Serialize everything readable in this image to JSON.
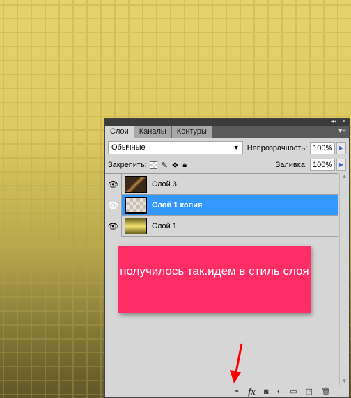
{
  "panel": {
    "tabs": [
      "Слои",
      "Каналы",
      "Контуры"
    ],
    "blend_mode": "Обычные",
    "opacity_label": "Непрозрачность:",
    "opacity": "100%",
    "lock_label": "Закрепить:",
    "fill_label": "Заливка:",
    "fill": "100%",
    "layers": [
      {
        "name": "Слой 3",
        "selected": false
      },
      {
        "name": "Слой 1 копия",
        "selected": true
      },
      {
        "name": "Слой 1",
        "selected": false
      }
    ],
    "bottom_icons": [
      "link-icon",
      "fx-icon",
      "mask-icon",
      "adjustment-icon",
      "folder-icon",
      "new-layer-icon",
      "trash-icon"
    ],
    "fx_label": "fx"
  },
  "annotation": {
    "text": "получилось так.идем в стиль слоя",
    "color": "#ff2d65",
    "arrow_color": "#ff0000"
  },
  "colors": {
    "selection": "#3399ff"
  }
}
